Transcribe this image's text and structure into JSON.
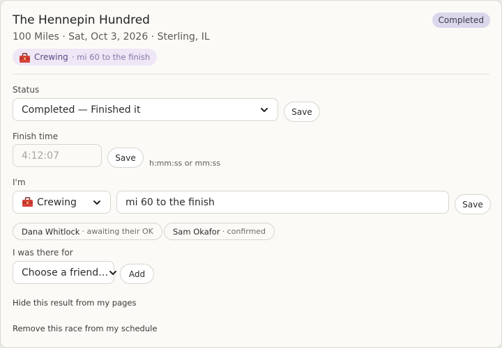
{
  "race": {
    "title": "The Hennepin Hundred",
    "subtitle": "100 Miles · Sat, Oct 3, 2026 · Sterling, IL",
    "status_badge": "Completed",
    "role_pill": {
      "role": "Crewing",
      "detail": "· mi 60 to the finish"
    }
  },
  "status": {
    "label": "Status",
    "value": "Completed — Finished it",
    "save_label": "Save"
  },
  "finish_time": {
    "label": "Finish time",
    "placeholder": "4:12:07",
    "save_label": "Save",
    "hint": "h:mm:ss or mm:ss"
  },
  "role": {
    "label": "I'm",
    "value": "Crewing",
    "detail_value": "mi 60 to the finish",
    "save_label": "Save"
  },
  "people": [
    {
      "name": "Dana Whitlock",
      "state": "· awaiting their OK"
    },
    {
      "name": "Sam Okafor",
      "state": "· confirmed"
    }
  ],
  "there_for": {
    "label": "I was there for",
    "placeholder": "Choose a friend…",
    "add_label": "Add"
  },
  "actions": {
    "hide": "Hide this result from my pages",
    "remove": "Remove this race from my schedule"
  },
  "colors": {
    "badge_bg": "#dcd8ec",
    "pill_bg": "#efe7f6",
    "toolbox": "#d6403a"
  }
}
